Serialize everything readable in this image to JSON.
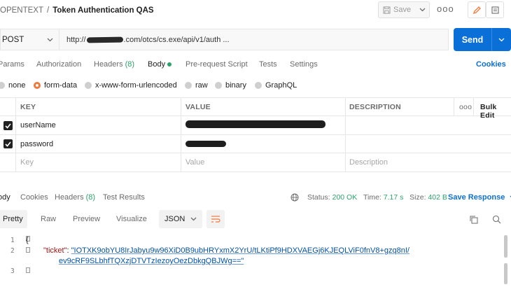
{
  "header": {
    "workspace": "OPENTEXT",
    "separator": "/",
    "request_name": "Token Authentication QAS",
    "save_label": "Save",
    "more_label": "ooo"
  },
  "request": {
    "method": "POST",
    "url_prefix": "http://",
    "url_suffix": ".com/otcs/cs.exe/api/v1/auth ...",
    "send_label": "Send"
  },
  "request_tabs": [
    {
      "label": "Params"
    },
    {
      "label": "Authorization"
    },
    {
      "label": "Headers",
      "count": "(8)"
    },
    {
      "label": "Body"
    },
    {
      "label": "Pre-request Script"
    },
    {
      "label": "Tests"
    },
    {
      "label": "Settings"
    }
  ],
  "cookies_label": "Cookies",
  "body_types": [
    "none",
    "form-data",
    "x-www-form-urlencoded",
    "raw",
    "binary",
    "GraphQL"
  ],
  "body_type_selected": "form-data",
  "params_table": {
    "columns": [
      "KEY",
      "VALUE",
      "DESCRIPTION"
    ],
    "more": "ooo",
    "bulk_edit": "Bulk Edit",
    "rows": [
      {
        "key": "userName",
        "checked": true
      },
      {
        "key": "password",
        "checked": true
      }
    ],
    "placeholder": {
      "key": "Key",
      "value": "Value",
      "description": "Description"
    }
  },
  "response": {
    "tabs": [
      {
        "label": "ody"
      },
      {
        "label": "Cookies"
      },
      {
        "label": "Headers",
        "count": "(8)"
      },
      {
        "label": "Test Results"
      }
    ],
    "status_label": "Status:",
    "status_value": "200 OK",
    "time_label": "Time:",
    "time_value": "7.17 s",
    "size_label": "Size:",
    "size_value": "402 B",
    "save_response": "Save Response",
    "view_modes": [
      "Pretty",
      "Raw",
      "Preview",
      "Visualize"
    ],
    "format": "JSON",
    "code_lines": [
      {
        "n": "1",
        "text": "{"
      },
      {
        "n": "2",
        "key": "\"ticket\"",
        "colon": ": ",
        "value_part1": "\"IOTXK9obYU8IrJabyu9w96XiD0B9ubHRYxmX2YrU/tLKtiPf9HDXVAEGj6KJEQLViF0fnV8+gzq8nI/"
      },
      {
        "n": "",
        "value_part2": "ev9cRF9SLbhfTQXzjDTVTzIezoyOezDbkgQBJWg==\""
      },
      {
        "n": "3",
        "text": "}"
      }
    ]
  },
  "icons": {
    "save": "save-icon",
    "edit": "pencil-icon",
    "docs": "document-icon",
    "globe": "globe-icon",
    "copy": "copy-icon",
    "search": "search-icon",
    "wrap": "wrap-lines-icon"
  },
  "colors": {
    "accent_blue": "#0b6fd8",
    "accent_orange": "#f0793c",
    "success_green": "#2aa36b"
  }
}
